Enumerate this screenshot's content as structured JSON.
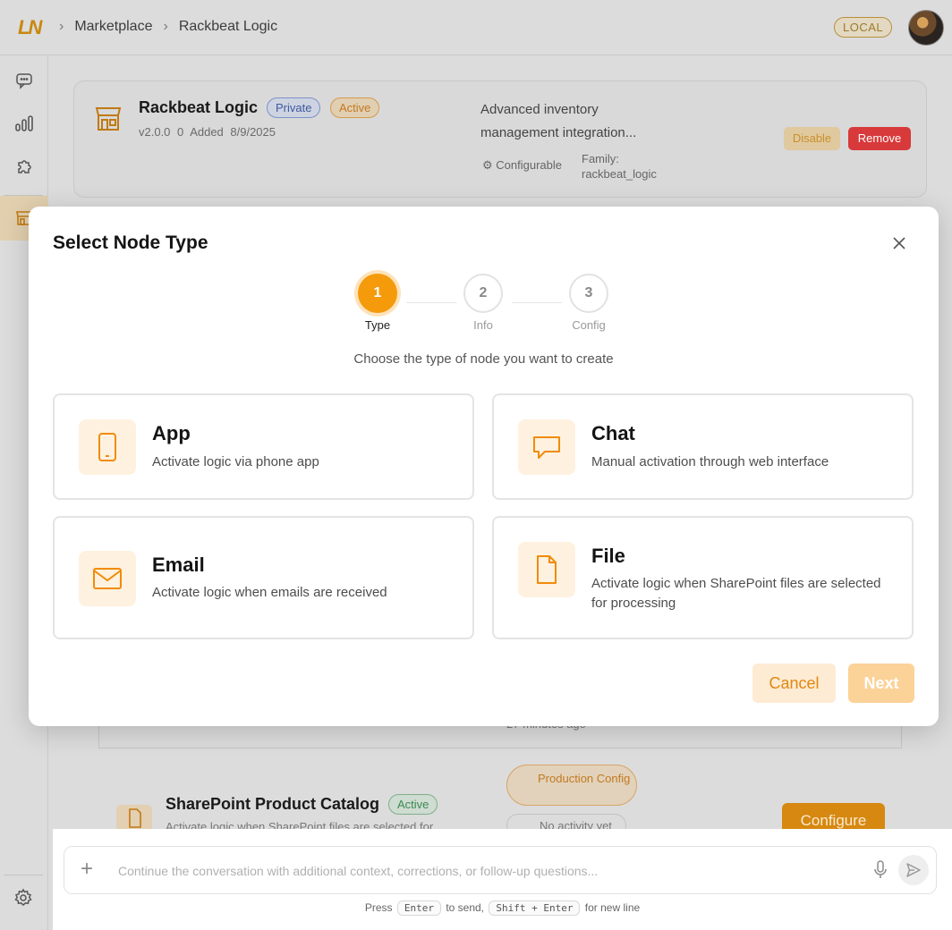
{
  "topbar": {
    "logo_text": "LN",
    "breadcrumbs": [
      "Marketplace",
      "Rackbeat Logic"
    ],
    "environment_badge": "LOCAL"
  },
  "background_card": {
    "title": "Rackbeat Logic",
    "visibility_badge": "Private",
    "status_badge": "Active",
    "version": "v2.0.0",
    "count": "0",
    "added": "Added 8/9/2025",
    "description": "Advanced inventory management integration...",
    "configurable_label": "Configurable",
    "family_label": "Family:",
    "family_value": "rackbeat_logic",
    "disable_label": "Disable",
    "remove_label": "Remove"
  },
  "background_lower": {
    "minutes_text": "27 minutes ago",
    "node_title": "SharePoint Product Catalog",
    "node_status": "Active",
    "node_desc": "Activate logic when SharePoint files are selected for",
    "production_config": "Production Config",
    "no_activity": "No activity yet",
    "configure_label": "Configure"
  },
  "modal": {
    "title": "Select Node Type",
    "steps": [
      {
        "number": "1",
        "label": "Type",
        "state": "active"
      },
      {
        "number": "2",
        "label": "Info",
        "state": "idle"
      },
      {
        "number": "3",
        "label": "Config",
        "state": "idle"
      }
    ],
    "subtitle": "Choose the type of node you want to create",
    "types": [
      {
        "name": "App",
        "description": "Activate logic via phone app",
        "icon": "phone-icon"
      },
      {
        "name": "Chat",
        "description": "Manual activation through web interface",
        "icon": "chat-bubble-icon"
      },
      {
        "name": "Email",
        "description": "Activate logic when emails are received",
        "icon": "mail-icon"
      },
      {
        "name": "File",
        "description": "Activate logic when SharePoint files are selected for processing",
        "icon": "file-icon"
      }
    ],
    "cancel_label": "Cancel",
    "next_label": "Next"
  },
  "chat": {
    "placeholder": "Continue the conversation with additional context, corrections, or follow-up questions...",
    "hint_press": "Press",
    "hint_enter": "Enter",
    "hint_to_send": "to send,",
    "hint_shift_enter": "Shift + Enter",
    "hint_new_line": "for new line"
  },
  "colors": {
    "accent": "#f59a0b",
    "accent_light": "#fff1df",
    "danger": "#d8393a"
  }
}
